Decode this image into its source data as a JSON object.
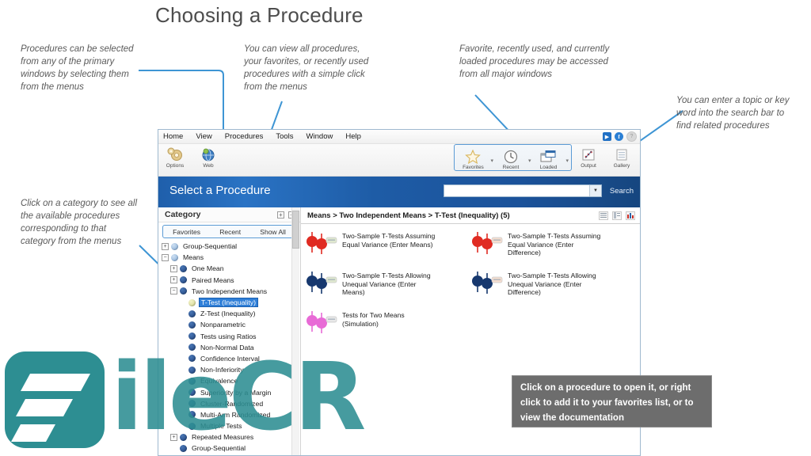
{
  "slide": {
    "title": "Choosing a Procedure"
  },
  "callouts": [
    {
      "id": "menus",
      "lines": [
        "Procedures can be selected",
        "from any of the primary",
        "windows by selecting them",
        "from the menus"
      ]
    },
    {
      "id": "view-all",
      "lines": [
        "You can view all procedures,",
        "your favorites, or recently used",
        "procedures with a simple click",
        "from the menus"
      ]
    },
    {
      "id": "favorites",
      "lines": [
        "Favorite, recently used, and currently",
        "loaded procedures may be accessed",
        "from all major windows"
      ]
    },
    {
      "id": "search",
      "lines": [
        "You can enter a topic or key",
        "word into the search bar to",
        "find related procedures"
      ]
    },
    {
      "id": "category",
      "lines": [
        "Click on a category to see all",
        "the available procedures",
        "corresponding to that",
        "category from the menus"
      ]
    }
  ],
  "app": {
    "menubar": {
      "items": [
        "Home",
        "View",
        "Procedures",
        "Tools",
        "Window",
        "Help"
      ],
      "window_buttons": [
        {
          "name": "video-button",
          "glyph": "▶"
        },
        {
          "name": "info-button",
          "glyph": "f"
        },
        {
          "name": "help-button",
          "glyph": "?"
        }
      ]
    },
    "ribbon": {
      "left": [
        {
          "label": "Options",
          "icon": "gear-icon"
        },
        {
          "label": "Web",
          "icon": "globe-icon"
        }
      ],
      "group": [
        {
          "label": "Favorites",
          "icon": "star-icon"
        },
        {
          "label": "Recent",
          "icon": "clock-icon"
        },
        {
          "label": "Loaded",
          "icon": "window-icon"
        }
      ],
      "right": [
        {
          "label": "Output",
          "icon": "chart-icon"
        },
        {
          "label": "Gallery",
          "icon": "gallery-icon"
        }
      ],
      "split_marker": "▾"
    },
    "bluebar": {
      "title": "Select a Procedure",
      "search_value": "",
      "search_placeholder": "",
      "search_button": "Search",
      "dropdown_glyph": "▼"
    },
    "category_panel": {
      "title": "Category",
      "expand_glyph": "+",
      "collapse_glyph": "−",
      "tabs": [
        "Favorites",
        "Recent",
        "Show All"
      ],
      "tree": [
        {
          "label": "Group-Sequential",
          "indent": 0,
          "toggle": "+",
          "dot": "lt",
          "selected": false
        },
        {
          "label": "Means",
          "indent": 0,
          "toggle": "−",
          "dot": "lt",
          "selected": false
        },
        {
          "label": "One Mean",
          "indent": 1,
          "toggle": "+",
          "dot": "dk",
          "selected": false
        },
        {
          "label": "Paired Means",
          "indent": 1,
          "toggle": "+",
          "dot": "dk",
          "selected": false
        },
        {
          "label": "Two Independent Means",
          "indent": 1,
          "toggle": "−",
          "dot": "dk",
          "selected": false
        },
        {
          "label": "T-Test (Inequality)",
          "indent": 2,
          "toggle": "",
          "dot": "yl",
          "selected": true
        },
        {
          "label": "Z-Test (Inequality)",
          "indent": 2,
          "toggle": "",
          "dot": "dk",
          "selected": false
        },
        {
          "label": "Nonparametric",
          "indent": 2,
          "toggle": "",
          "dot": "dk",
          "selected": false
        },
        {
          "label": "Tests using Ratios",
          "indent": 2,
          "toggle": "",
          "dot": "dk",
          "selected": false
        },
        {
          "label": "Non-Normal Data",
          "indent": 2,
          "toggle": "",
          "dot": "dk",
          "selected": false
        },
        {
          "label": "Confidence Interval",
          "indent": 2,
          "toggle": "",
          "dot": "dk",
          "selected": false
        },
        {
          "label": "Non-Inferiority",
          "indent": 2,
          "toggle": "",
          "dot": "dk",
          "selected": false
        },
        {
          "label": "Equivalence",
          "indent": 2,
          "toggle": "",
          "dot": "dk",
          "selected": false
        },
        {
          "label": "Superiority by a Margin",
          "indent": 2,
          "toggle": "",
          "dot": "dk",
          "selected": false
        },
        {
          "label": "Cluster-Randomized",
          "indent": 2,
          "toggle": "",
          "dot": "dk",
          "selected": false
        },
        {
          "label": "Multi-Arm Randomized",
          "indent": 2,
          "toggle": "",
          "dot": "dk",
          "selected": false
        },
        {
          "label": "Multiple Tests",
          "indent": 2,
          "toggle": "",
          "dot": "dk",
          "selected": false
        },
        {
          "label": "Repeated Measures",
          "indent": 1,
          "toggle": "+",
          "dot": "dk",
          "selected": false
        },
        {
          "label": "Group-Sequential",
          "indent": 1,
          "toggle": "",
          "dot": "dk",
          "selected": false
        }
      ]
    },
    "procedure_panel": {
      "breadcrumb": "Means > Two Independent Means > T-Test (Inequality) (5)",
      "view_buttons": [
        "list-view-icon",
        "detail-view-icon",
        "chart-view-icon"
      ],
      "procedures": [
        {
          "title": [
            "Two-Sample T-Tests Assuming",
            "Equal Variance (Enter Means)"
          ],
          "color": "#e02b22",
          "badge": "#dfe8cf"
        },
        {
          "title": [
            "Two-Sample T-Tests Assuming",
            "Equal Variance (Enter",
            "Difference)"
          ],
          "color": "#e02b22",
          "badge": "#f5ded0"
        },
        {
          "title": [
            "Two-Sample T-Tests Allowing",
            "Unequal Variance (Enter",
            "Means)"
          ],
          "color": "#17386e",
          "badge": "#dfe8cf"
        },
        {
          "title": [
            "Two-Sample T-Tests Allowing",
            "Unequal Variance (Enter",
            "Difference)"
          ],
          "color": "#17386e",
          "badge": "#f5ded0"
        },
        {
          "title": [
            "Tests for Two Means",
            "(Simulation)"
          ],
          "color": "#e86bd6",
          "badge": "#e8e8e8"
        }
      ]
    }
  },
  "tooltip": {
    "lines": [
      "Click on a procedure to open it, or right",
      "click to add it to your favorites list, or to",
      "view the documentation"
    ]
  },
  "watermark": {
    "text": "ileCR",
    "color": "#2d8e92"
  }
}
